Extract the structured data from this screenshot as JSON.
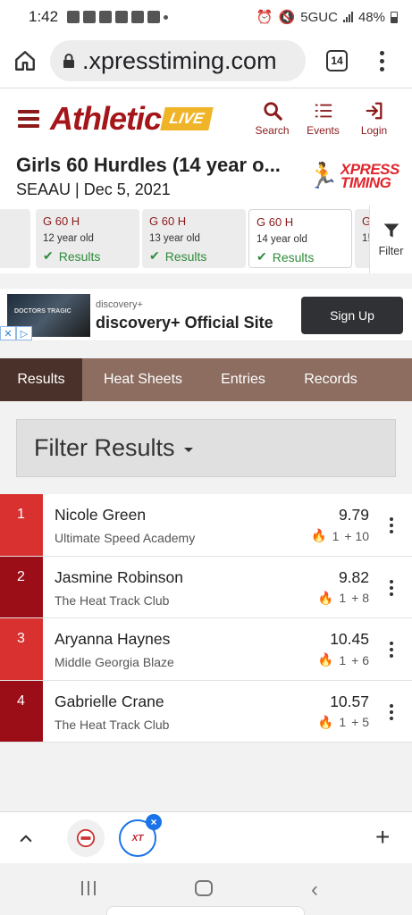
{
  "status": {
    "time": "1:42",
    "network": "5GUC",
    "battery": "48%",
    "notification_icons": [
      "ring-icon",
      "app-icon",
      "instagram-icon",
      "chess-icon",
      "cloud-icon",
      "image-icon",
      "dot-icon"
    ]
  },
  "browser": {
    "url": ".xpresstiming.com",
    "tab_count": "14"
  },
  "header": {
    "logo_text": "Athletic",
    "logo_badge": "LIVE",
    "nav": [
      {
        "label": "Search",
        "icon": "search-icon"
      },
      {
        "label": "Events",
        "icon": "events-list-icon"
      },
      {
        "label": "Login",
        "icon": "login-icon"
      }
    ]
  },
  "event": {
    "title": "Girls 60 Hurdles (14 year o...",
    "subtitle": "SEAAU | Dec 5, 2021",
    "brand_line1": "XPRESS",
    "brand_line2": "TIMING"
  },
  "event_cards": [
    {
      "name": "G 60 H",
      "age": "12 year old",
      "status": "Results"
    },
    {
      "name": "G 60 H",
      "age": "13 year old",
      "status": "Results"
    },
    {
      "name": "G 60 H",
      "age": "14 year old",
      "status": "Results"
    },
    {
      "name": "G",
      "age": "1!",
      "status": ""
    }
  ],
  "filter_button": "Filter",
  "ad": {
    "thumb_text": "DOCTORS TRAGIC",
    "advertiser": "discovery+",
    "title": "discovery+ Official Site",
    "cta": "Sign Up"
  },
  "tabs": [
    "Results",
    "Heat Sheets",
    "Entries",
    "Records"
  ],
  "filter_results_label": "Filter Results",
  "results": [
    {
      "place": "1",
      "name": "Nicole Green",
      "team": "Ultimate Speed Academy",
      "mark": "9.79",
      "heat": "1",
      "wind": "+ 10",
      "color": "#d93030"
    },
    {
      "place": "2",
      "name": "Jasmine Robinson",
      "team": "The Heat Track Club",
      "mark": "9.82",
      "heat": "1",
      "wind": "+ 8",
      "color": "#9b0d17"
    },
    {
      "place": "3",
      "name": "Aryanna Haynes",
      "team": "Middle Georgia Blaze",
      "mark": "10.45",
      "heat": "1",
      "wind": "+ 6",
      "color": "#d93030"
    },
    {
      "place": "4",
      "name": "Gabrielle Crane",
      "team": "The Heat Track Club",
      "mark": "10.57",
      "heat": "1",
      "wind": "+ 5",
      "color": "#9b0d17"
    }
  ],
  "bottom_bar": {
    "tab1_icon": "athletic-live-tab-icon",
    "tab2_label": "XT",
    "close": "×",
    "plus": "+"
  },
  "colors": {
    "brand_red": "#8b1a1a",
    "tab_bar": "#8c6d60",
    "tab_active": "#4a3129",
    "results_green": "#2e8b3a",
    "live_yellow": "#f0b429"
  }
}
